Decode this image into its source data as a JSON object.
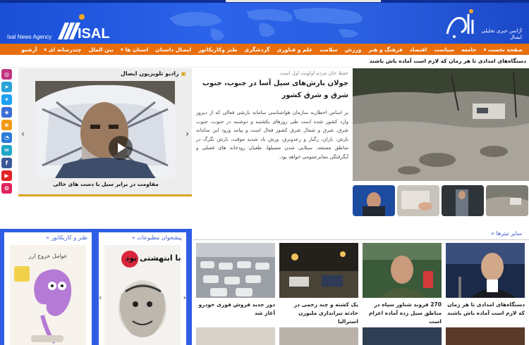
{
  "header": {
    "agency_en": "Isal News Agency",
    "logo_text": "ISAL",
    "tagline": "آژانس خبری تحلیلی ایصال",
    "colors": {
      "brand_blue": "#2b63ea",
      "nav_orange": "#e86e0c",
      "accent_gold": "#d9a520"
    }
  },
  "nav": {
    "items": [
      "صفحه نخست ▾",
      "جامعه",
      "سیاست",
      "اقتصاد",
      "فرهنگ و هنر",
      "ورزش",
      "سلامت",
      "علم و فناوری",
      "گردشگری",
      "طنز وکاریکاتور",
      "ایصال داستان",
      "استان ها ▾",
      "بین الملل",
      "چندرسانه ای ▾",
      "آرشیو"
    ]
  },
  "ticker": {
    "text": "دستگاه‌های امدادی تا هر زمان که لازم است آماده باش باشند"
  },
  "social": {
    "icons": [
      {
        "name": "instagram-icon",
        "glyph": "◎",
        "color": "#c13584"
      },
      {
        "name": "telegram-icon",
        "glyph": "➤",
        "color": "#2aa3d8"
      },
      {
        "name": "twitter-icon",
        "glyph": "✦",
        "color": "#1da1f2"
      },
      {
        "name": "shield-icon",
        "glyph": "◈",
        "color": "#3b6ed6"
      },
      {
        "name": "eitaa-icon",
        "glyph": "e",
        "color": "#f29a17"
      },
      {
        "name": "soroush-icon",
        "glyph": "◔",
        "color": "#2b7bd8"
      },
      {
        "name": "bale-icon",
        "glyph": "✉",
        "color": "#1fa8c6"
      },
      {
        "name": "facebook-icon",
        "glyph": "f",
        "color": "#3b5998"
      },
      {
        "name": "youtube-icon",
        "glyph": "▶",
        "color": "#e02424"
      },
      {
        "name": "aparat-icon",
        "glyph": "✿",
        "color": "#e0245e"
      }
    ]
  },
  "tv": {
    "title": "رادیو تلویزیون ایصال",
    "caption": "مقاومت در برابر سیل با دست های خالی"
  },
  "lead": {
    "kicker": "حفظ جان مردم اولویت اول است",
    "headline": "جولان بارش‌های سیل آسا در جنوب، جنوب شرق و شرق کشور",
    "body": "بر اساس اخطاریه سازمان هواشناسی سامانه بارشی فعالی که از دیروز وارد کشور شده است طی روزهای یکشنبه و دوشنبه در جنوب، جنوب شرق، شرق و شمال شرق کشور فعال است و پیامد ورود این سامانه بارش، باران، رگبار و رعدوبرق، وزش باد شدید موقت، بارش تگرگ در مناطق مستعد، سیلابی شدن مسیلها، طغیان رودخانه های فصلی و آبگرفتگی معابرعمومی خواهد بود."
  },
  "cards": {
    "newspapers": {
      "title": "پیشخوان مطبوعات",
      "cover_text": "حق با ابتهشتی بود"
    },
    "cartoon": {
      "title": "طنز و کاریکاتور",
      "cover_text": "عوامل خروج ارز"
    }
  },
  "other_news": {
    "title": "سایر تیترها",
    "items": [
      {
        "text": "دستگاه‌های امدادی تا هر زمان که لازم است آماده باش باشند"
      },
      {
        "text": "270 فروند شناور سپاه در مناطق سیل زده آماده اعزام است"
      },
      {
        "text": "یک کشته و چند زخمی در حادثه تیراندازی ملبورن استرالیا"
      },
      {
        "text": "دور جدید فروش فوری خودرو آغاز شد"
      }
    ]
  }
}
